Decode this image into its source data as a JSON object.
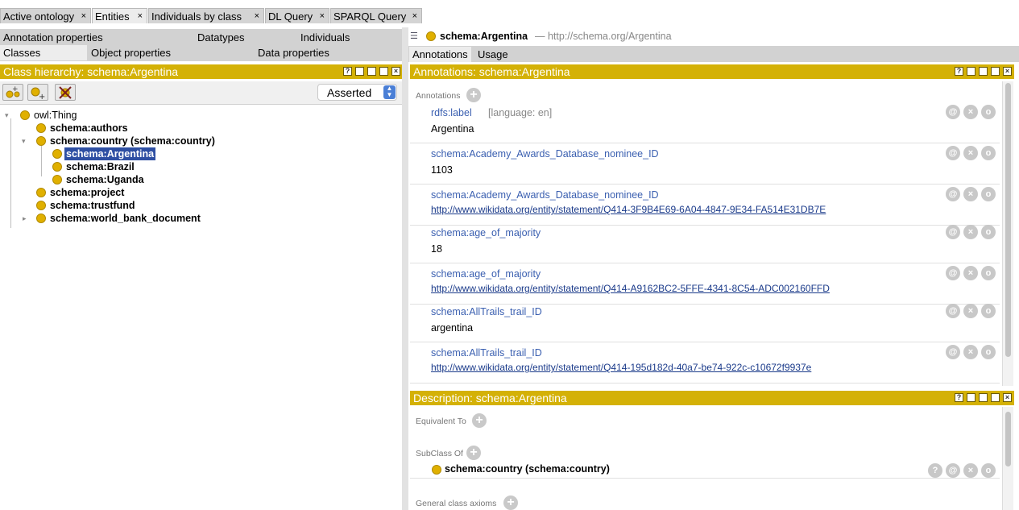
{
  "main_tabs": [
    {
      "label": "Active ontology",
      "close": "×"
    },
    {
      "label": "Entities",
      "close": "×"
    },
    {
      "label": "Individuals by class",
      "close": "×"
    },
    {
      "label": "DL Query",
      "close": "×"
    },
    {
      "label": "SPARQL Query",
      "close": "×"
    }
  ],
  "left_tabs": {
    "row1": [
      "Annotation properties",
      "Datatypes",
      "Individuals"
    ],
    "row2": [
      "Classes",
      "Object properties",
      "Data properties"
    ]
  },
  "class_hierarchy": {
    "title": "Class hierarchy: schema:Argentina",
    "mode": "Asserted",
    "tree": [
      {
        "label": "owl:Thing"
      },
      {
        "label": "schema:authors"
      },
      {
        "label": "schema:country (schema:country)"
      },
      {
        "label": "schema:Argentina"
      },
      {
        "label": "schema:Brazil"
      },
      {
        "label": "schema:Uganda"
      },
      {
        "label": "schema:project"
      },
      {
        "label": "schema:trustfund"
      },
      {
        "label": "schema:world_bank_document"
      }
    ]
  },
  "entity": {
    "name": "schema:Argentina",
    "iri": "— http://schema.org/Argentina"
  },
  "right_tabs": [
    "Annotations",
    "Usage"
  ],
  "annotations_panel": {
    "title": "Annotations: schema:Argentina",
    "section": "Annotations",
    "items": [
      {
        "property": "rdfs:label",
        "lang": "[language: en]",
        "value": "Argentina",
        "is_link": false
      },
      {
        "property": "schema:Academy_Awards_Database_nominee_ID",
        "lang": "",
        "value": "1103",
        "is_link": false
      },
      {
        "property": "schema:Academy_Awards_Database_nominee_ID",
        "lang": "",
        "value": "http://www.wikidata.org/entity/statement/Q414-3F9B4E69-6A04-4847-9E34-FA514E31DB7E",
        "is_link": true
      },
      {
        "property": "schema:age_of_majority",
        "lang": "",
        "value": "18",
        "is_link": false
      },
      {
        "property": "schema:age_of_majority",
        "lang": "",
        "value": "http://www.wikidata.org/entity/statement/Q414-A9162BC2-5FFE-4341-8C54-ADC002160FFD",
        "is_link": true
      },
      {
        "property": "schema:AllTrails_trail_ID",
        "lang": "",
        "value": "argentina",
        "is_link": false
      },
      {
        "property": "schema:AllTrails_trail_ID",
        "lang": "",
        "value": "http://www.wikidata.org/entity/statement/Q414-195d182d-40a7-be74-922c-c10672f9937e",
        "is_link": true
      }
    ],
    "item_buttons": [
      "@",
      "×",
      "o"
    ]
  },
  "description_panel": {
    "title": "Description: schema:Argentina",
    "equivalent_to": "Equivalent To",
    "subclass_of": "SubClass Of",
    "subclass_value": "schema:country (schema:country)",
    "subclass_buttons": [
      "?",
      "@",
      "×",
      "o"
    ],
    "general_axioms": "General class axioms"
  },
  "bar_buttons": [
    "?",
    "",
    "",
    "",
    "×"
  ],
  "colors": {
    "accent": "#d4b106",
    "selection": "#2e4fa3",
    "link": "#3a5fb0"
  }
}
